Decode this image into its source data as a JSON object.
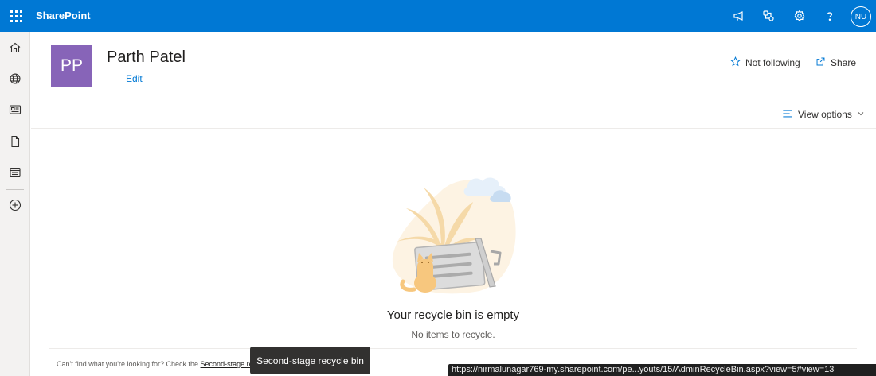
{
  "topbar": {
    "app_name": "SharePoint",
    "icons": [
      "waffle-icon",
      "megaphone-icon",
      "connections-icon",
      "settings-icon",
      "help-icon"
    ],
    "user_initials": "NU",
    "color": "#0078d4"
  },
  "leftnav": {
    "items": [
      "home-icon",
      "globe-icon",
      "news-icon",
      "document-icon",
      "list-icon",
      "add-circle-icon"
    ]
  },
  "site": {
    "logo_initials": "PP",
    "logo_color": "#8764b8",
    "title": "Parth Patel",
    "edit_label": "Edit",
    "follow_label": "Not following",
    "share_label": "Share",
    "view_options_label": "View options"
  },
  "empty_state": {
    "title": "Your recycle bin is empty",
    "subtitle": "No items to recycle."
  },
  "footer": {
    "prefix": "Can't find what you're looking for? Check the ",
    "link_label": "Second-stage recycle bin"
  },
  "tooltip": {
    "text": "Second-stage recycle bin"
  },
  "statusbar": {
    "url": "https://nirmalunagar769-my.sharepoint.com/pe...youts/15/AdminRecycleBin.aspx?view=5#view=13"
  }
}
